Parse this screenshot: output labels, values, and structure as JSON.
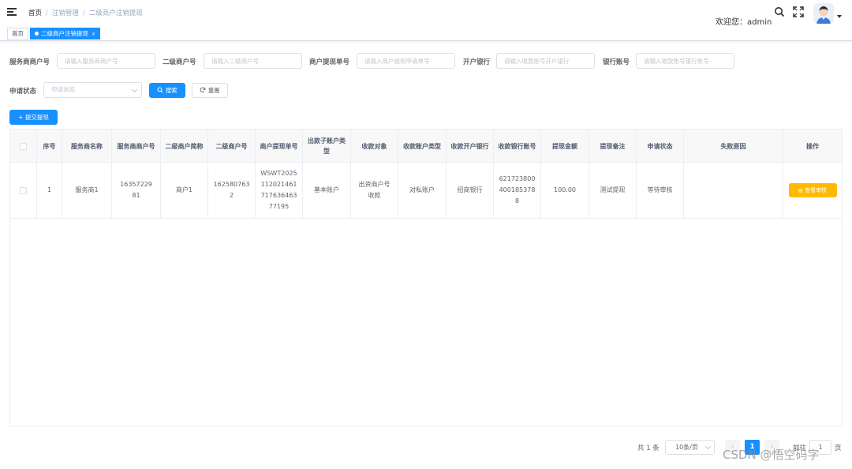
{
  "breadcrumb": [
    "首页",
    "注销管理",
    "二级商户注销提现"
  ],
  "header": {
    "welcome": "欢迎您：admin"
  },
  "tags": {
    "home": "首页",
    "active": "二级商户注销提现",
    "close": "×"
  },
  "search": {
    "fields": [
      {
        "label": "服务商商户号",
        "placeholder": "请输入服务商商户号"
      },
      {
        "label": "二级商户号",
        "placeholder": "请输入二级商户号"
      },
      {
        "label": "商户提现单号",
        "placeholder": "请输入商户提现申请单号"
      },
      {
        "label": "开户银行",
        "placeholder": "请输入收款账号开户银行"
      },
      {
        "label": "银行账号",
        "placeholder": "请输入收款账号银行账号"
      }
    ],
    "status_label": "申请状态",
    "status_placeholder": "申请状态",
    "search_btn": "搜索",
    "reset_btn": "重置"
  },
  "toolbar": {
    "submit_label": "+ 提交提现"
  },
  "table": {
    "columns": [
      "",
      "序号",
      "服务商名称",
      "服务商商户号",
      "二级商户简称",
      "二级商户号",
      "商户提现单号",
      "出款子账户类型",
      "收款对象",
      "收款账户类型",
      "收款开户银行",
      "收款银行账号",
      "提现金额",
      "提现备注",
      "申请状态",
      "失败原因",
      "操作"
    ],
    "rows": [
      [
        "",
        "1",
        "服务商1",
        "1635722981",
        "商户1",
        "1625807632",
        "WSWT202511202146171763646377195",
        "基本账户",
        "出资商户号收款",
        "对私账户",
        "招商银行",
        "6217238004001853788",
        "100.00",
        "测试提现",
        "等待审核",
        "",
        "查看审核"
      ]
    ]
  },
  "pagination": {
    "total": "共 1 条",
    "page_size": "10条/页",
    "prev": "‹",
    "current": "1",
    "next": "›",
    "goto": "前往",
    "goto_value": "1",
    "page_unit": "页"
  },
  "watermark": "CSDN @悟空码字",
  "colors": {
    "primary": "#1890ff",
    "warning": "#ffba00",
    "border": "#ebeef5"
  }
}
